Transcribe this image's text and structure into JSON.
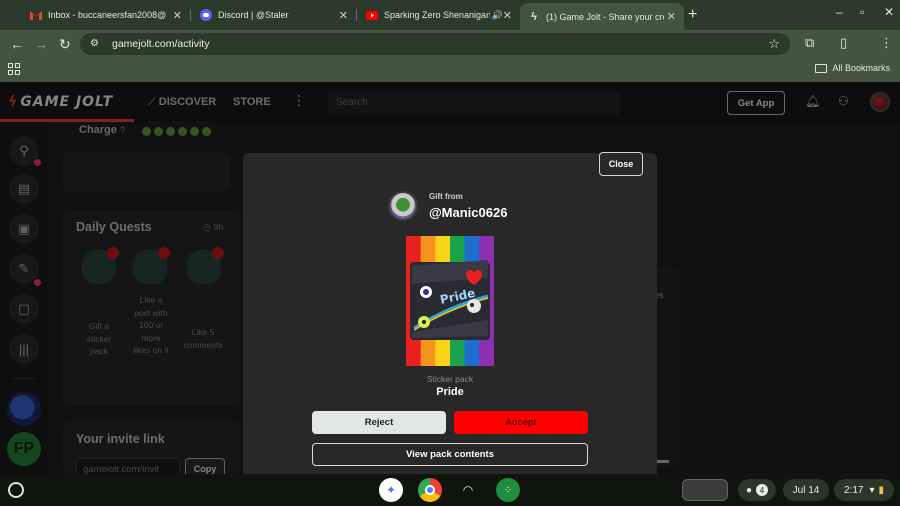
{
  "browser": {
    "tabs": [
      {
        "title": "Inbox - buccaneersfan2008@g",
        "icon": "gmail-icon"
      },
      {
        "title": "Discord | @Staler",
        "icon": "discord-icon"
      },
      {
        "title": "Sparking Zero Shenanigans",
        "icon": "youtube-icon"
      },
      {
        "title": "(1) Game Jolt - Share your crea",
        "icon": "gamejolt-icon"
      }
    ],
    "url": "gamejolt.com/activity",
    "bookmarks_label": "All Bookmarks"
  },
  "site": {
    "logo": "GAME JOLT",
    "nav": {
      "discover": "DISCOVER",
      "store": "STORE"
    },
    "search_placeholder": "Search",
    "get_app": "Get App",
    "charge_label": "Charge",
    "daily_quests": {
      "title": "Daily Quests",
      "timer": "9h",
      "quests": [
        "Gift a sticker pack",
        "Like a post with 100 or more likes on it",
        "Like 5 comments"
      ]
    },
    "invite": {
      "title": "Your invite link",
      "url": "gameiolt.com/invit",
      "copy": "Copy"
    },
    "bg_text_fragment": "es"
  },
  "modal": {
    "close": "Close",
    "gift_from": "Gift from",
    "username": "@Manic0626",
    "pack_type": "Sticker pack",
    "pack_name": "Pride",
    "reject": "Reject",
    "accept": "Accept",
    "view_contents": "View pack contents",
    "pack_colors": [
      "#e8211f",
      "#f7941d",
      "#f7d417",
      "#1aa34a",
      "#1c6fd1",
      "#8d2fb0"
    ]
  },
  "shelf": {
    "date": "Jul 14",
    "time": "2:17",
    "notification_count": "4"
  }
}
